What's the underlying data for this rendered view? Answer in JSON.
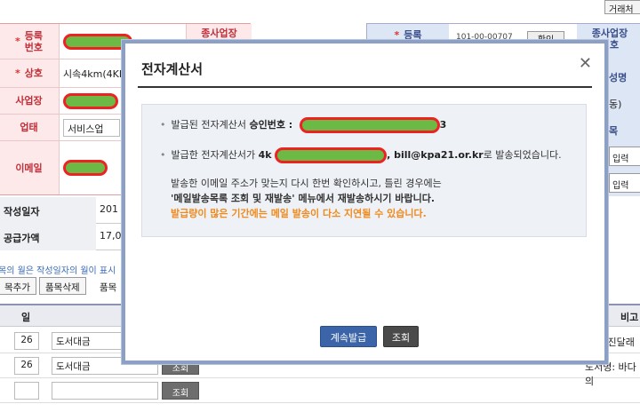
{
  "toolbar": {
    "top_button": "거래처"
  },
  "supplier": {
    "reg_label": "등록\n번호",
    "workplace_label": "종사업장\n번호",
    "name_label": "상호",
    "name_value": "시속4km(4KM",
    "address_label": "사업장",
    "business_label": "업태",
    "business_value": "서비스업",
    "email_label": "이메일"
  },
  "buyer": {
    "reg_label": "등록\n번호",
    "reg_value": "101-00-00707",
    "check_button": "확인",
    "workplace_label": "종사업장\n번호",
    "name_label": "성명",
    "address_suffix": "동)",
    "type_label": "목",
    "input1": "입력",
    "input2": "입력"
  },
  "dates": {
    "write_date_label": "작성일자",
    "write_date_value": "201",
    "supply_label": "공급가액",
    "supply_value": "17,00"
  },
  "note": "목의 월은 작성일자의 월이 표시",
  "item_buttons": {
    "add": "목추가",
    "delete": "품목삭제",
    "label": "품목"
  },
  "items": {
    "head_day": "일",
    "head_b": "비고",
    "rows": [
      {
        "day": "26",
        "name": "도서대금",
        "note": "): 진달래"
      },
      {
        "day": "26",
        "name": "도서대금",
        "lookup": "조회",
        "note": "도서명: 바다의"
      },
      {
        "day": "",
        "name": "",
        "lookup": "조회",
        "note": ""
      }
    ]
  },
  "modal": {
    "title": "전자계산서",
    "line1_prefix": "발급된 전자계산서 ",
    "line1_bold": "승인번호 :",
    "line1_suffix": "3",
    "line2_prefix": "발급한 전자계산서가 ",
    "line2_bold1": "4k",
    "line2_bold2": ", bill@kpa21.or.kr",
    "line2_suffix": "로 발송되었습니다.",
    "para1": "발송한 이메일 주소가 맞는지 다시 한번 확인하시고, 틀린 경우에는",
    "para2": "'메일발송목록 조회 및 재발송' 메뉴에서 재발송하시기 바랍니다.",
    "para3": "발급량이 많은 기간에는 메일 발송이 다소 지연될 수 있습니다.",
    "continue_button": "계속발급",
    "lookup_button": "조회"
  },
  "colors": {
    "redaction": "#6cb945",
    "redaction_border": "#e22",
    "warning": "#f08a1c",
    "primary": "#3b65a8"
  }
}
